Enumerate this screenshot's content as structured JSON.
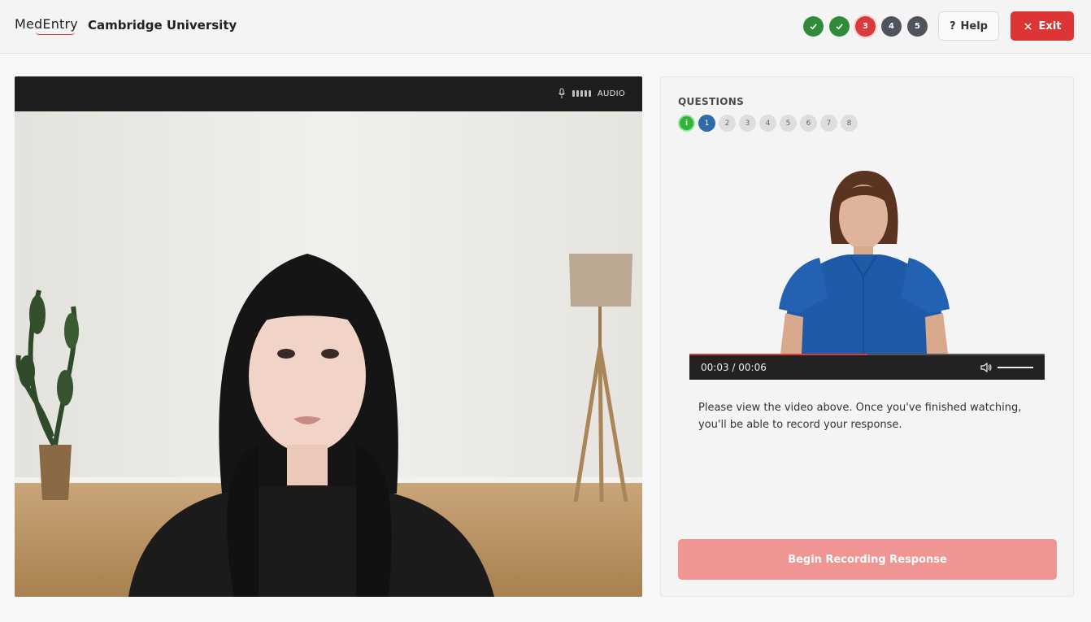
{
  "header": {
    "logo_text": "MedEntry",
    "university": "Cambridge University",
    "steps": [
      {
        "label": "",
        "state": "done"
      },
      {
        "label": "",
        "state": "done"
      },
      {
        "label": "3",
        "state": "current"
      },
      {
        "label": "4",
        "state": "todo"
      },
      {
        "label": "5",
        "state": "todo"
      }
    ],
    "help_label": "Help",
    "help_icon": "?",
    "exit_label": "Exit"
  },
  "webcam": {
    "audio_label": "AUDIO"
  },
  "questions": {
    "label": "QUESTIONS",
    "items": [
      "i",
      "1",
      "2",
      "3",
      "4",
      "5",
      "6",
      "7",
      "8"
    ],
    "active_index": 1
  },
  "video": {
    "time": "00:03 / 00:06",
    "progress": 0.5
  },
  "instructions": "Please view the video above. Once you've finished watching, you'll be able to record your response.",
  "record_button": "Begin Recording Response",
  "colors": {
    "accent": "#dc3535",
    "step_done": "#2f8a3a",
    "step_todo": "#4e545c",
    "question_active": "#2c6aa8",
    "record_button": "#ef9593"
  }
}
